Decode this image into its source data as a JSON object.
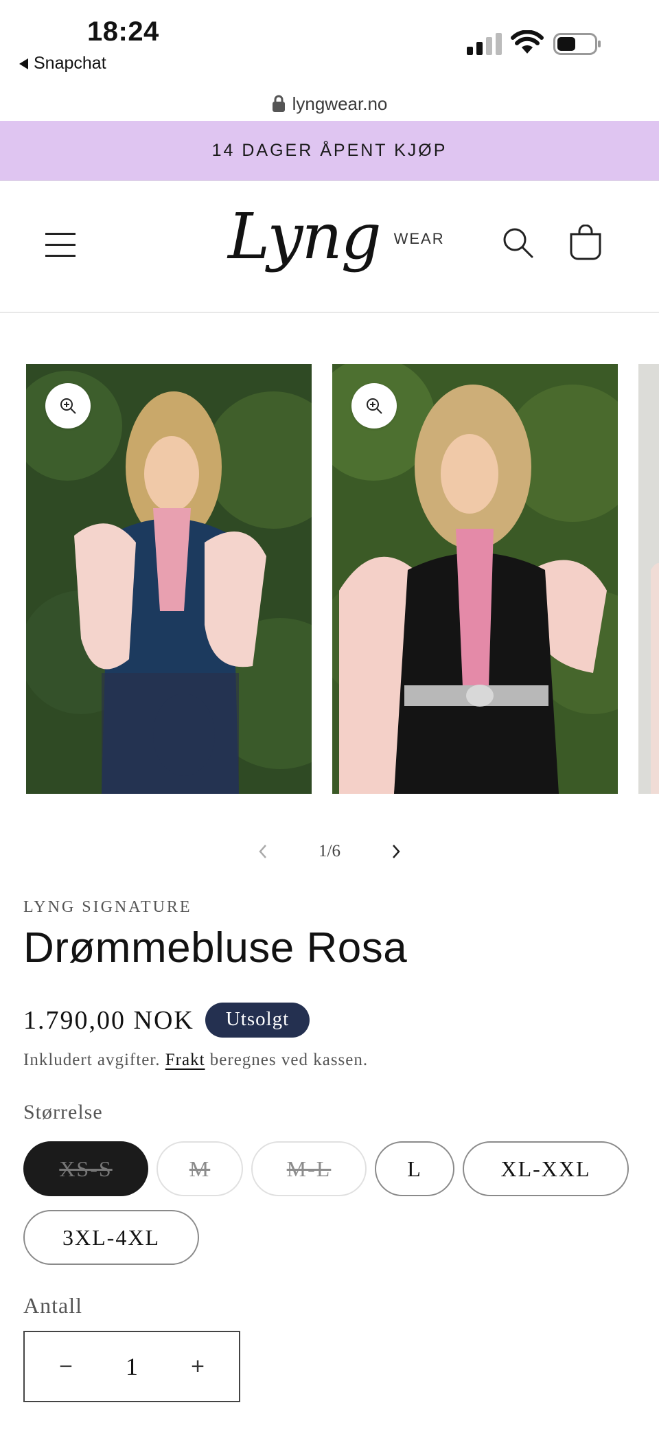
{
  "status_bar": {
    "time": "18:24",
    "back_app": "Snapchat"
  },
  "browser": {
    "url": "lyngwear.no"
  },
  "announcement": "14 DAGER ÅPENT KJØP",
  "header": {
    "logo_script": "Lyng",
    "logo_suffix": "WEAR"
  },
  "gallery": {
    "counter": "1/6",
    "total_visible_slides": 3
  },
  "product": {
    "vendor": "LYNG SIGNATURE",
    "title": "Drømmebluse Rosa",
    "price": "1.790,00 NOK",
    "badge": "Utsolgt",
    "tax_prefix": "Inkludert avgifter.",
    "tax_link": "Frakt",
    "tax_suffix": "beregnes ved kassen."
  },
  "size": {
    "label": "Størrelse",
    "options": [
      {
        "label": "XS-S",
        "state": "selected-unavailable"
      },
      {
        "label": "M",
        "state": "unavailable"
      },
      {
        "label": "M-L",
        "state": "unavailable"
      },
      {
        "label": "L",
        "state": "available"
      },
      {
        "label": "XL-XXL",
        "state": "available"
      },
      {
        "label": "3XL-4XL",
        "state": "available"
      }
    ]
  },
  "quantity": {
    "label": "Antall",
    "value": "1",
    "minus": "−",
    "plus": "+"
  },
  "colors": {
    "announcement_bg": "#dfc5f1",
    "badge_bg": "#243050",
    "selected_pill": "#1b1b1b"
  }
}
